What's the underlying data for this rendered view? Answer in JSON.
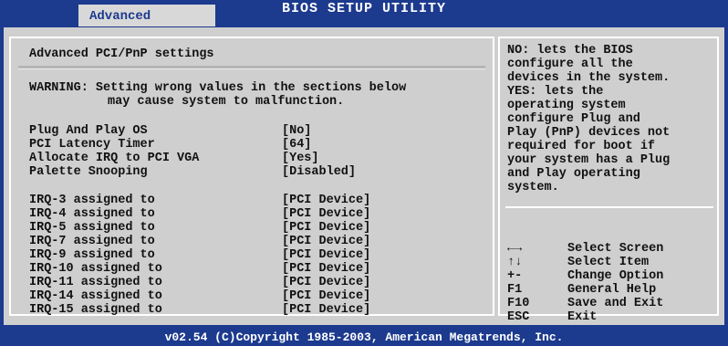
{
  "header": {
    "title": "BIOS SETUP UTILITY",
    "active_tab": "Advanced"
  },
  "main": {
    "section_title": "Advanced PCI/PnP settings",
    "warning_line1": "WARNING: Setting wrong values in the sections below",
    "warning_line2": "may cause system to malfunction.",
    "settings": [
      {
        "label": "Plug And Play OS",
        "value": "[No]"
      },
      {
        "label": "PCI Latency Timer",
        "value": "[64]"
      },
      {
        "label": "Allocate IRQ to PCI VGA",
        "value": "[Yes]"
      },
      {
        "label": "Palette Snooping",
        "value": "[Disabled]"
      }
    ],
    "irqs": [
      {
        "label": "IRQ-3 assigned to",
        "value": "[PCI Device]"
      },
      {
        "label": "IRQ-4 assigned to",
        "value": "[PCI Device]"
      },
      {
        "label": "IRQ-5 assigned to",
        "value": "[PCI Device]"
      },
      {
        "label": "IRQ-7 assigned to",
        "value": "[PCI Device]"
      },
      {
        "label": "IRQ-9 assigned to",
        "value": "[PCI Device]"
      },
      {
        "label": "IRQ-10 assigned to",
        "value": "[PCI Device]"
      },
      {
        "label": "IRQ-11 assigned to",
        "value": "[PCI Device]"
      },
      {
        "label": "IRQ-14 assigned to",
        "value": "[PCI Device]"
      },
      {
        "label": "IRQ-15 assigned to",
        "value": "[PCI Device]"
      }
    ]
  },
  "help": {
    "lines": [
      "NO: lets the BIOS",
      "configure all the",
      "devices in the system.",
      "YES: lets the",
      "operating system",
      "configure Plug and",
      "Play (PnP) devices not",
      "required for boot if",
      "your system has a Plug",
      "and Play operating",
      "system."
    ],
    "keys": [
      {
        "key": "←→",
        "action": "Select Screen"
      },
      {
        "key": "↑↓",
        "action": "Select Item"
      },
      {
        "key": "+-",
        "action": "Change Option"
      },
      {
        "key": "F1",
        "action": "General Help"
      },
      {
        "key": "F10",
        "action": "Save and Exit"
      },
      {
        "key": "ESC",
        "action": "Exit"
      }
    ]
  },
  "footer": {
    "copyright": "v02.54 (C)Copyright 1985-2003, American Megatrends, Inc."
  }
}
